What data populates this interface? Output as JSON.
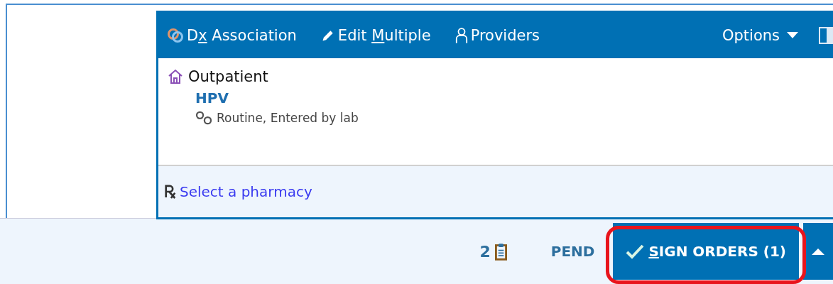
{
  "toolbar": {
    "items": [
      {
        "kind": "dx",
        "label_parts": [
          "D",
          "x",
          " Association"
        ]
      },
      {
        "kind": "edit",
        "label_parts": [
          "Edit ",
          "M",
          "ultiple"
        ]
      },
      {
        "kind": "providers",
        "label_parts": [
          "Providers"
        ]
      }
    ],
    "options": "Options"
  },
  "order_group": {
    "setting": "Outpatient",
    "order_name": "HPV",
    "details": "Routine, Entered by lab"
  },
  "pharmacy_link": "Select a pharmacy",
  "action_bar": {
    "count": "2",
    "pend": "PEND",
    "sign": {
      "label_parts": [
        "S",
        "IGN ORDERS (1)"
      ],
      "highlighted": true
    }
  }
}
